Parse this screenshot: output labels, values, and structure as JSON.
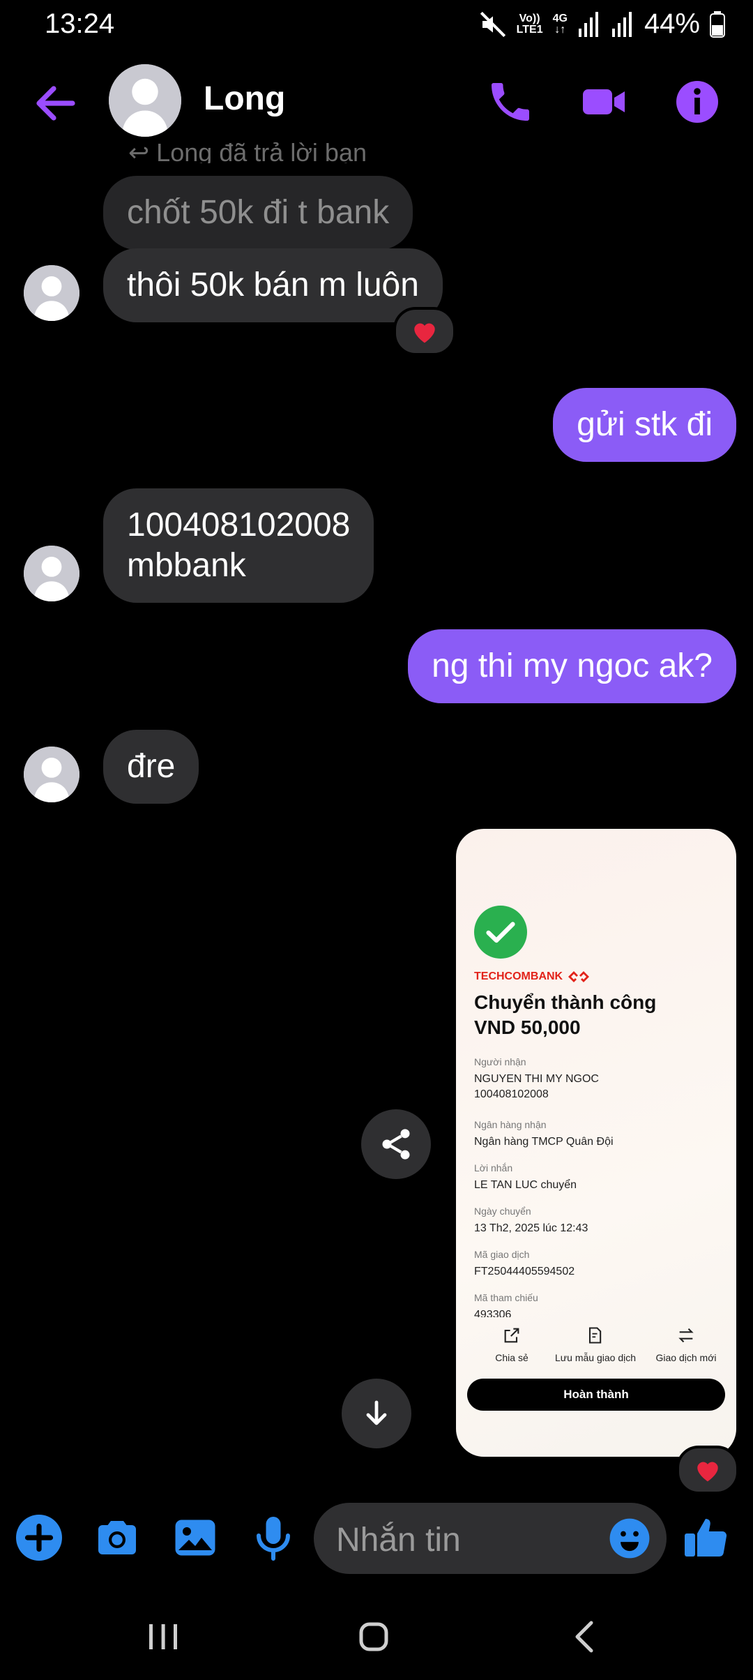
{
  "status_bar": {
    "time": "13:24",
    "network_top": "Vo))",
    "network_bottom": "LTE1",
    "network_type": "4G",
    "battery": "44%"
  },
  "header": {
    "contact_name": "Long",
    "icons": [
      "back-arrow-icon",
      "phone-icon",
      "video-camera-icon",
      "info-icon"
    ],
    "accent_color": "#9b4dff"
  },
  "messages": {
    "reply_note": "↩ Long đã trả lời bạn",
    "quoted": "chốt 50k đi t bank",
    "m1": "thôi 50k bán m luôn",
    "m2": "gửi stk đi",
    "m3_line1": "100408102008",
    "m3_line2": "mbbank",
    "m4": "ng thi my ngoc ak?",
    "m5": "đre"
  },
  "receipt": {
    "bank_name": "TECHCOMBANK",
    "title": "Chuyển thành công",
    "amount": "VND 50,000",
    "recipient_label": "Người nhận",
    "recipient_name": "NGUYEN THI MY NGOC",
    "recipient_account": "100408102008",
    "bank_label": "Ngân hàng nhận",
    "bank_value": "Ngân hàng TMCP Quân Đội",
    "message_label": "Lời nhắn",
    "message_value": "LE TAN LUC chuyển",
    "date_label": "Ngày chuyển",
    "date_value": "13 Th2, 2025 lúc 12:43",
    "txn_label": "Mã giao dịch",
    "txn_value": "FT25044405594502",
    "ref_label": "Mã tham chiếu",
    "ref_value": "493306",
    "action_share": "Chia sẻ",
    "action_save": "Lưu mẫu giao dịch",
    "action_new": "Giao dịch mới",
    "done_button": "Hoàn thành"
  },
  "composer": {
    "placeholder": "Nhắn tin",
    "icons": [
      "plus-icon",
      "camera-icon",
      "gallery-icon",
      "microphone-icon",
      "emoji-icon",
      "thumbs-up-icon"
    ]
  },
  "colors": {
    "outgoing_bubble": "#8b5cf6",
    "incoming_bubble": "#2f2f31",
    "composer_accent": "#2e8cf0"
  }
}
